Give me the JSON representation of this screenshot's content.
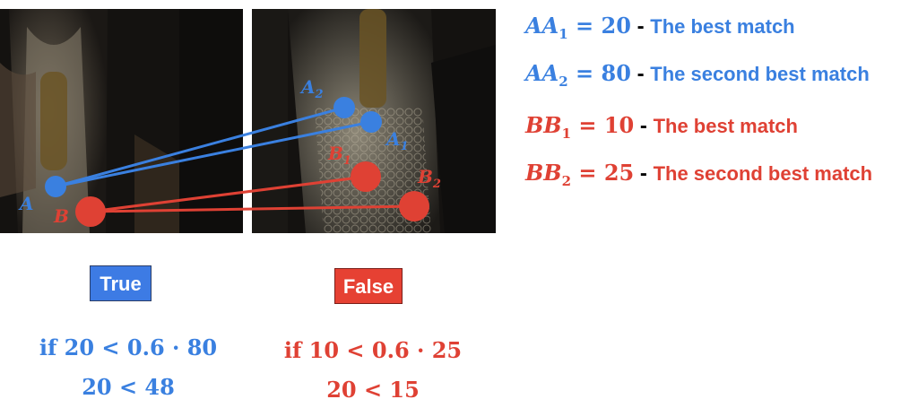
{
  "colors": {
    "blue": "#3a80e0",
    "red": "#df4134",
    "photo_dark": "#161412"
  },
  "photo_labels": {
    "A": "A",
    "B": "B",
    "A1_main": "A",
    "A1_sub": "1",
    "A2_main": "A",
    "A2_sub": "2",
    "B1_main": "B",
    "B1_sub": "1",
    "B2_main": "B",
    "B2_sub": "2"
  },
  "equations": [
    {
      "lhs": "AA",
      "sub": "1",
      "rhs": "= 20",
      "dash": " - ",
      "desc": "The best match",
      "color": "blue"
    },
    {
      "lhs": "AA",
      "sub": "2",
      "rhs": "= 80",
      "dash": " - ",
      "desc": "The second best match",
      "color": "blue"
    },
    {
      "lhs": "BB",
      "sub": "1",
      "rhs": "= 10",
      "dash": " - ",
      "desc": "The best match",
      "color": "red"
    },
    {
      "lhs": "BB",
      "sub": "2",
      "rhs": "= 25",
      "dash": " - ",
      "desc": "The second best match",
      "color": "red"
    }
  ],
  "results": {
    "true_label": "True",
    "false_label": "False"
  },
  "conditions": {
    "left_line1": "if 20 < 0.6 · 80",
    "left_line2": "20 < 48",
    "right_line1": "if 10 < 0.6 · 25",
    "right_line2": "20 < 15"
  }
}
